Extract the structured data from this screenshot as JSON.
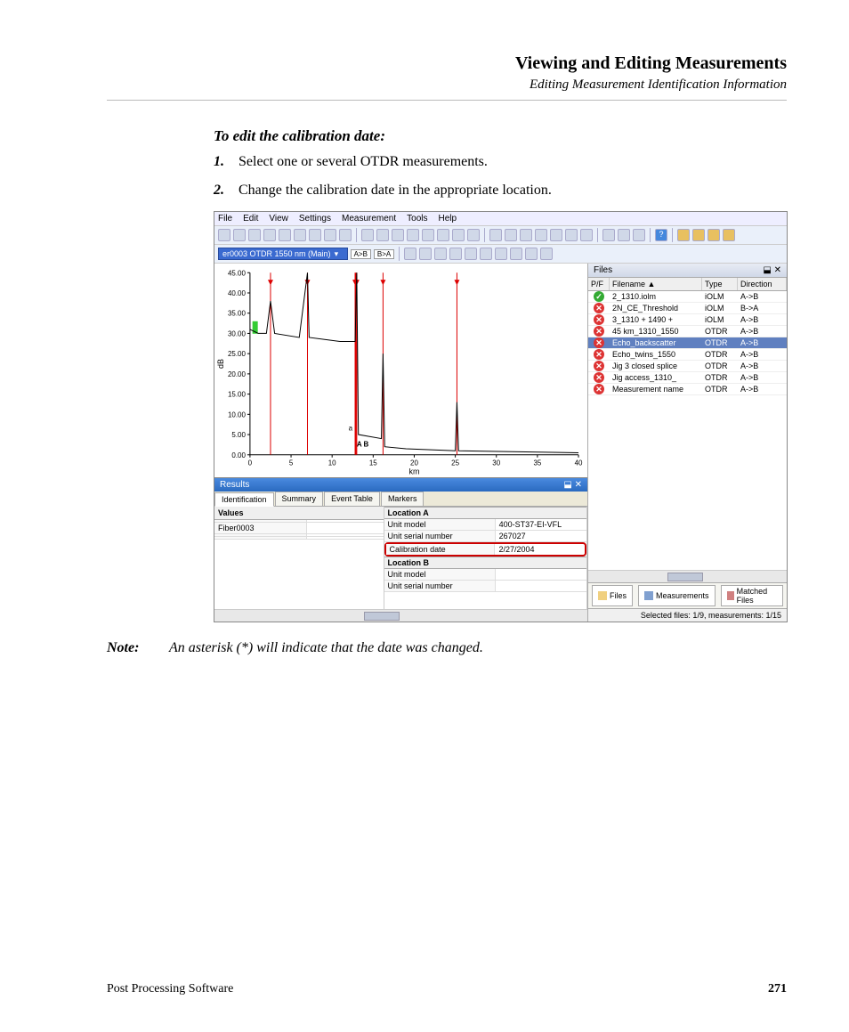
{
  "header": {
    "title": "Viewing and Editing Measurements",
    "subtitle": "Editing Measurement Identification Information"
  },
  "procedure": {
    "title": "To edit the calibration date:",
    "steps": [
      {
        "num": "1.",
        "text": "Select one or several OTDR measurements."
      },
      {
        "num": "2.",
        "text": "Change the calibration date in the appropriate location."
      }
    ]
  },
  "app": {
    "menu": [
      "File",
      "Edit",
      "View",
      "Settings",
      "Measurement",
      "Tools",
      "Help"
    ],
    "trace_selector": "er0003 OTDR 1550 nm (Main)",
    "ab_btn1": "A>B",
    "ab_btn2": "B>A",
    "files_panel": {
      "title": "Files",
      "pin_close": "⬓ ✕",
      "columns": {
        "pf": "P/F",
        "filename": "Filename",
        "sort": "▲",
        "type": "Type",
        "direction": "Direction"
      },
      "rows": [
        {
          "status": "pass",
          "name": "2_1310.iolm",
          "type": "iOLM",
          "dir": "A->B",
          "sel": false
        },
        {
          "status": "fail",
          "name": "2N_CE_Threshold",
          "type": "iOLM",
          "dir": "B->A",
          "sel": false
        },
        {
          "status": "fail",
          "name": "3_1310 + 1490 +",
          "type": "iOLM",
          "dir": "A->B",
          "sel": false
        },
        {
          "status": "fail",
          "name": "45 km_1310_1550",
          "type": "OTDR",
          "dir": "A->B",
          "sel": false
        },
        {
          "status": "fail",
          "name": "Echo_backscatter",
          "type": "OTDR",
          "dir": "A->B",
          "sel": true
        },
        {
          "status": "fail",
          "name": "Echo_twins_1550",
          "type": "OTDR",
          "dir": "A->B",
          "sel": false
        },
        {
          "status": "fail",
          "name": "Jig 3 closed splice",
          "type": "OTDR",
          "dir": "A->B",
          "sel": false
        },
        {
          "status": "fail",
          "name": "Jig access_1310_",
          "type": "OTDR",
          "dir": "A->B",
          "sel": false
        },
        {
          "status": "fail",
          "name": "Measurement name",
          "type": "OTDR",
          "dir": "A->B",
          "sel": false
        }
      ],
      "bottom_tabs": [
        "Files",
        "Measurements",
        "Matched Files"
      ]
    },
    "results": {
      "title": "Results",
      "pin_close": "⬓ ✕",
      "tabs": [
        "Identification",
        "Summary",
        "Event Table",
        "Markers"
      ],
      "left_header": "Values",
      "left_value": "Fiber0003",
      "right": {
        "locA": "Location A",
        "unit_model_k": "Unit model",
        "unit_model_v": "400-ST37-EI-VFL",
        "unit_serial_k": "Unit serial number",
        "unit_serial_v": "267027",
        "cal_date_k": "Calibration date",
        "cal_date_v": "2/27/2004",
        "locB": "Location B",
        "unit_model_b_k": "Unit model",
        "unit_serial_b_k": "Unit serial number"
      }
    },
    "statusbar": "Selected files: 1/9, measurements: 1/15",
    "chart": {
      "ylabel": "dB",
      "xlabel": "km",
      "markers": "A B",
      "marker_a": "a"
    },
    "chart_data": {
      "type": "line",
      "xlabel": "km",
      "ylabel": "dB",
      "xlim": [
        0,
        40
      ],
      "ylim": [
        0,
        45
      ],
      "xticks": [
        0,
        5,
        10,
        15,
        20,
        25,
        30,
        35,
        40
      ],
      "yticks": [
        0.0,
        5.0,
        10.0,
        15.0,
        20.0,
        25.0,
        30.0,
        35.0,
        40.0,
        45.0
      ],
      "trace": [
        {
          "x": 0,
          "y": 31
        },
        {
          "x": 1,
          "y": 30
        },
        {
          "x": 2,
          "y": 30
        },
        {
          "x": 2.5,
          "y": 38
        },
        {
          "x": 3,
          "y": 30
        },
        {
          "x": 6,
          "y": 29
        },
        {
          "x": 7,
          "y": 45
        },
        {
          "x": 7.2,
          "y": 29
        },
        {
          "x": 11,
          "y": 28
        },
        {
          "x": 12.8,
          "y": 28
        },
        {
          "x": 13,
          "y": 45
        },
        {
          "x": 13.2,
          "y": 5
        },
        {
          "x": 16,
          "y": 4
        },
        {
          "x": 16.2,
          "y": 25
        },
        {
          "x": 16.4,
          "y": 2
        },
        {
          "x": 19,
          "y": 1.5
        },
        {
          "x": 25,
          "y": 1
        },
        {
          "x": 25.2,
          "y": 13
        },
        {
          "x": 25.4,
          "y": 1
        },
        {
          "x": 40,
          "y": 0.5
        }
      ],
      "event_markers_x": [
        2.5,
        7.0,
        12.8,
        12.9,
        13.0,
        16.2,
        25.2
      ]
    }
  },
  "note": {
    "label": "Note:",
    "text": "An asterisk (*) will indicate that the date was changed."
  },
  "footer": {
    "left": "Post Processing Software",
    "right": "271"
  }
}
